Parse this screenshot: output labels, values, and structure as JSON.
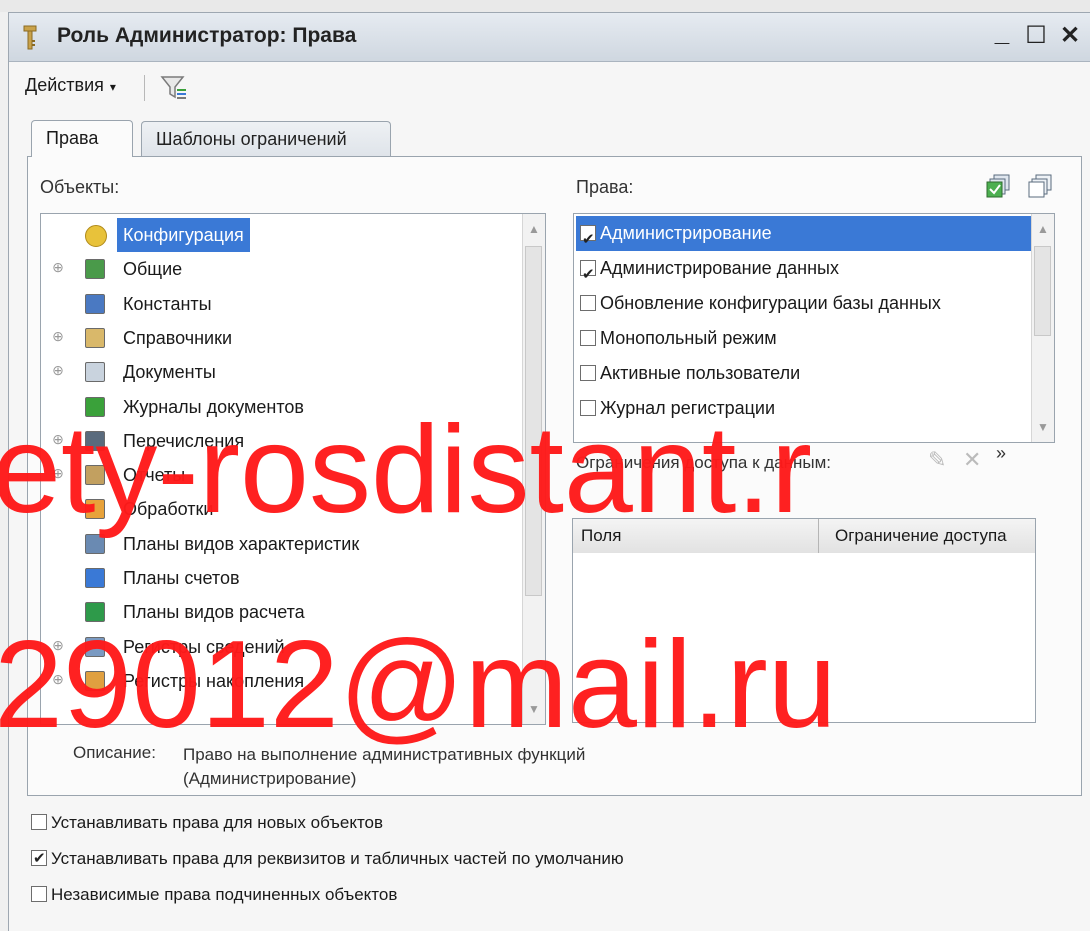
{
  "window": {
    "title": "Роль Администратор: Права",
    "minimize": "_",
    "maximize": "☐",
    "close": "✕"
  },
  "toolbar": {
    "actions_label": "Действия",
    "actions_arrow": "▾",
    "filter_icon": "filter-icon"
  },
  "tabs": [
    {
      "label": "Права",
      "active": true
    },
    {
      "label": "Шаблоны ограничений",
      "active": false
    }
  ],
  "objects": {
    "label": "Объекты:",
    "items": [
      {
        "label": "Конфигурация",
        "expander": "",
        "icon": "configuration-icon",
        "selected": true
      },
      {
        "label": "Общие",
        "expander": "⊕",
        "icon": "common-icon"
      },
      {
        "label": "Константы",
        "expander": "",
        "icon": "constants-icon"
      },
      {
        "label": "Справочники",
        "expander": "⊕",
        "icon": "catalogs-icon"
      },
      {
        "label": "Документы",
        "expander": "⊕",
        "icon": "documents-icon"
      },
      {
        "label": "Журналы документов",
        "expander": "",
        "icon": "journals-icon"
      },
      {
        "label": "Перечисления",
        "expander": "⊕",
        "icon": "enums-icon"
      },
      {
        "label": "Отчеты",
        "expander": "⊕",
        "icon": "reports-icon"
      },
      {
        "label": "Обработки",
        "expander": "",
        "icon": "dataprocessors-icon"
      },
      {
        "label": "Планы видов характеристик",
        "expander": "",
        "icon": "chart-of-characteristic-types-icon"
      },
      {
        "label": "Планы счетов",
        "expander": "",
        "icon": "chart-of-accounts-icon"
      },
      {
        "label": "Планы видов расчета",
        "expander": "",
        "icon": "chart-of-calculation-types-icon"
      },
      {
        "label": "Регистры сведений",
        "expander": "⊕",
        "icon": "information-registers-icon"
      },
      {
        "label": "Регистры накопления",
        "expander": "⊕",
        "icon": "accumulation-registers-icon"
      }
    ]
  },
  "rights": {
    "label": "Права:",
    "items": [
      {
        "label": "Администрирование",
        "checked": true,
        "selected": true
      },
      {
        "label": "Администрирование данных",
        "checked": true
      },
      {
        "label": "Обновление конфигурации базы данных",
        "checked": false
      },
      {
        "label": "Монопольный режим",
        "checked": false
      },
      {
        "label": "Активные пользователи",
        "checked": false
      },
      {
        "label": "Журнал регистрации",
        "checked": false
      }
    ]
  },
  "restrictions": {
    "label": "Ограничения доступа к данным:",
    "columns": [
      "Поля",
      "Ограничение доступа"
    ]
  },
  "description": {
    "label": "Описание:",
    "line1": "Право на выполнение административных функций",
    "line2": "(Администрирование)"
  },
  "options": [
    {
      "label": "Устанавливать права для новых объектов",
      "checked": false
    },
    {
      "label": "Устанавливать права для реквизитов и табличных частей по умолчанию",
      "checked": true
    },
    {
      "label": "Независимые права подчиненных объектов",
      "checked": false
    }
  ],
  "watermark": {
    "line1": "ety-rosdistant.r",
    "line2": "29012@mail.ru"
  },
  "colors": {
    "selection": "#3a79d6",
    "watermark": "#ff1a1a"
  }
}
